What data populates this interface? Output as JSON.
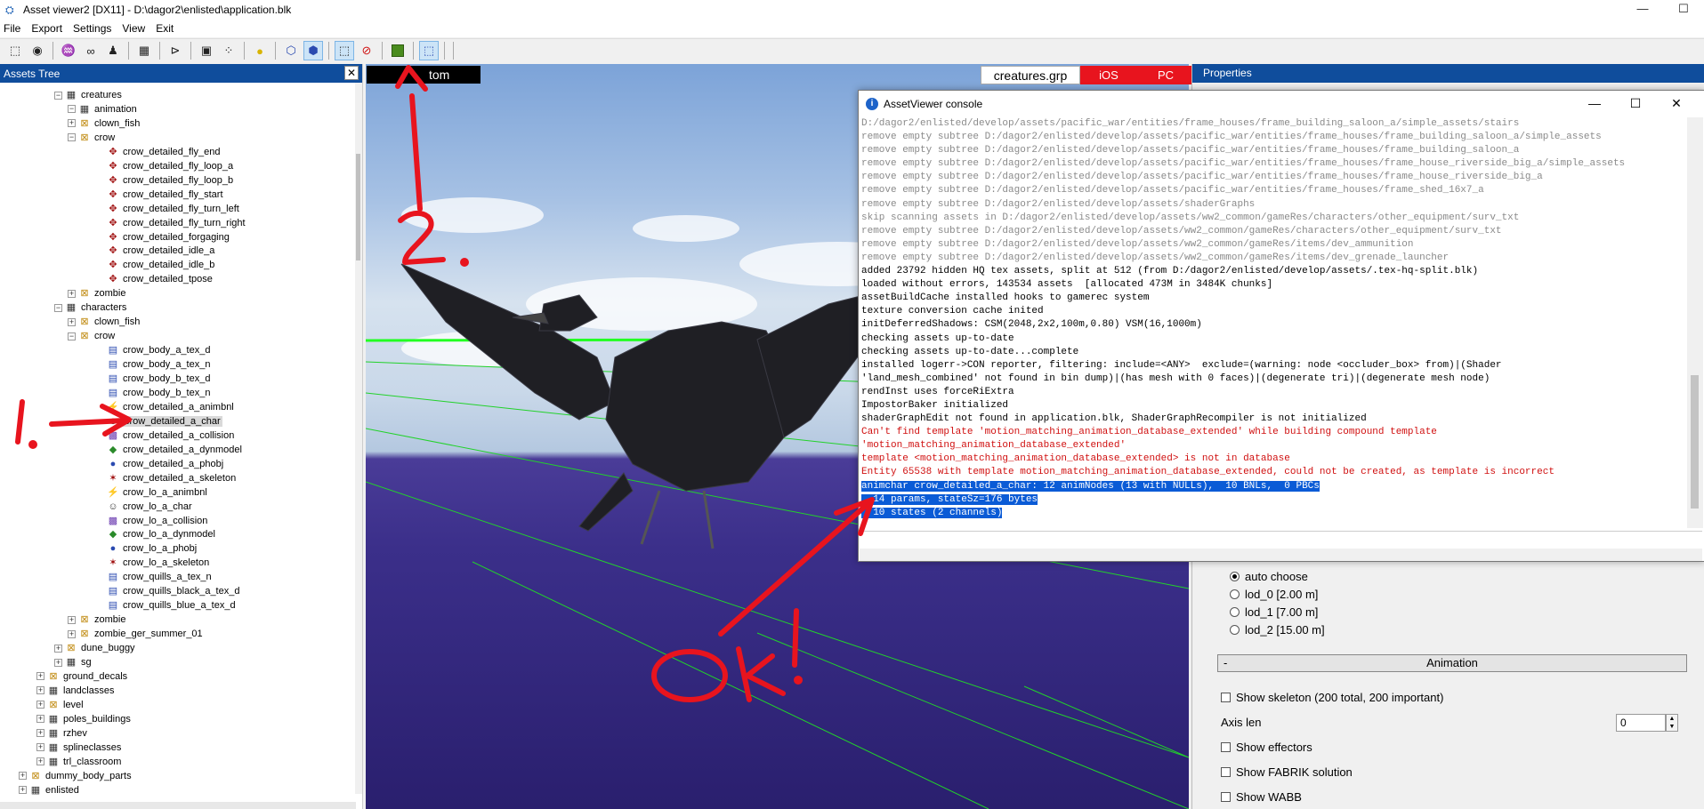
{
  "window": {
    "title": "Asset viewer2  [DX11]  -  D:\\dagor2\\enlisted\\application.blk",
    "minimize": "—",
    "maximize": "☐"
  },
  "menu": [
    "File",
    "Export",
    "Settings",
    "View",
    "Exit"
  ],
  "toolbar_icons": [
    "frame-icon",
    "eye-icon",
    "wave-icon",
    "links-icon",
    "figure-icon",
    "grid-icon",
    "camera-back-icon",
    "camera-icon",
    "dots-icon",
    "sun-icon",
    "cube-icon",
    "cube-solid-icon",
    "frame2-icon",
    "no-shadow-icon",
    "green-square-icon",
    "dotted-frame-icon"
  ],
  "tree": {
    "title": "Assets Tree",
    "close": "✕",
    "items": [
      {
        "label": "creatures",
        "kind": "group"
      },
      {
        "label": "animation",
        "kind": "group"
      },
      {
        "label": "clown_fish",
        "kind": "folder"
      },
      {
        "label": "crow",
        "kind": "folder"
      },
      {
        "label": "crow_detailed_fly_end",
        "kind": "anim"
      },
      {
        "label": "crow_detailed_fly_loop_a",
        "kind": "anim"
      },
      {
        "label": "crow_detailed_fly_loop_b",
        "kind": "anim"
      },
      {
        "label": "crow_detailed_fly_start",
        "kind": "anim"
      },
      {
        "label": "crow_detailed_fly_turn_left",
        "kind": "anim"
      },
      {
        "label": "crow_detailed_fly_turn_right",
        "kind": "anim"
      },
      {
        "label": "crow_detailed_forgaging",
        "kind": "anim"
      },
      {
        "label": "crow_detailed_idle_a",
        "kind": "anim"
      },
      {
        "label": "crow_detailed_idle_b",
        "kind": "anim"
      },
      {
        "label": "crow_detailed_tpose",
        "kind": "anim"
      },
      {
        "label": "zombie",
        "kind": "folder"
      },
      {
        "label": "characters",
        "kind": "group"
      },
      {
        "label": "clown_fish",
        "kind": "folder"
      },
      {
        "label": "crow",
        "kind": "folder"
      },
      {
        "label": "crow_body_a_tex_d",
        "kind": "tex"
      },
      {
        "label": "crow_body_a_tex_n",
        "kind": "tex"
      },
      {
        "label": "crow_body_b_tex_d",
        "kind": "tex"
      },
      {
        "label": "crow_body_b_tex_n",
        "kind": "tex"
      },
      {
        "label": "crow_detailed_a_animbnl",
        "kind": "animbnl"
      },
      {
        "label": "crow_detailed_a_char",
        "kind": "char"
      },
      {
        "label": "crow_detailed_a_collision",
        "kind": "collision"
      },
      {
        "label": "crow_detailed_a_dynmodel",
        "kind": "dynmodel"
      },
      {
        "label": "crow_detailed_a_phobj",
        "kind": "phobj"
      },
      {
        "label": "crow_detailed_a_skeleton",
        "kind": "skeleton"
      },
      {
        "label": "crow_lo_a_animbnl",
        "kind": "animbnl"
      },
      {
        "label": "crow_lo_a_char",
        "kind": "char"
      },
      {
        "label": "crow_lo_a_collision",
        "kind": "collision"
      },
      {
        "label": "crow_lo_a_dynmodel",
        "kind": "dynmodel"
      },
      {
        "label": "crow_lo_a_phobj",
        "kind": "phobj"
      },
      {
        "label": "crow_lo_a_skeleton",
        "kind": "skeleton"
      },
      {
        "label": "crow_quills_a_tex_n",
        "kind": "tex"
      },
      {
        "label": "crow_quills_black_a_tex_d",
        "kind": "tex"
      },
      {
        "label": "crow_quills_blue_a_tex_d",
        "kind": "tex"
      },
      {
        "label": "zombie",
        "kind": "folder"
      },
      {
        "label": "zombie_ger_summer_01",
        "kind": "folder"
      },
      {
        "label": "dune_buggy",
        "kind": "folder"
      },
      {
        "label": "sg",
        "kind": "group"
      },
      {
        "label": "ground_decals",
        "kind": "folder"
      },
      {
        "label": "landclasses",
        "kind": "group"
      },
      {
        "label": "level",
        "kind": "folder"
      },
      {
        "label": "poles_buildings",
        "kind": "group"
      },
      {
        "label": "rzhev",
        "kind": "group"
      },
      {
        "label": "splineclasses",
        "kind": "group"
      },
      {
        "label": "trl_classroom",
        "kind": "group"
      },
      {
        "label": "dummy_body_parts",
        "kind": "folder"
      },
      {
        "label": "enlisted",
        "kind": "group"
      }
    ]
  },
  "viewport": {
    "label": "tom",
    "file": "creatures.grp",
    "platforms": [
      "iOS",
      "PC"
    ],
    "platform_color": "#e8141e"
  },
  "console": {
    "title": "AssetViewer console",
    "close": "✕",
    "lines": [
      {
        "t": "D:/dagor2/enlisted/develop/assets/pacific_war/entities/frame_houses/frame_building_saloon_a/simple_assets/stairs",
        "c": "gray"
      },
      {
        "t": "remove empty subtree D:/dagor2/enlisted/develop/assets/pacific_war/entities/frame_houses/frame_building_saloon_a/simple_assets",
        "c": "gray"
      },
      {
        "t": "remove empty subtree D:/dagor2/enlisted/develop/assets/pacific_war/entities/frame_houses/frame_building_saloon_a",
        "c": "gray"
      },
      {
        "t": "remove empty subtree D:/dagor2/enlisted/develop/assets/pacific_war/entities/frame_houses/frame_house_riverside_big_a/simple_assets",
        "c": "gray"
      },
      {
        "t": "remove empty subtree D:/dagor2/enlisted/develop/assets/pacific_war/entities/frame_houses/frame_house_riverside_big_a",
        "c": "gray"
      },
      {
        "t": "remove empty subtree D:/dagor2/enlisted/develop/assets/pacific_war/entities/frame_houses/frame_shed_16x7_a",
        "c": "gray"
      },
      {
        "t": "remove empty subtree D:/dagor2/enlisted/develop/assets/shaderGraphs",
        "c": "gray"
      },
      {
        "t": "skip scanning assets in D:/dagor2/enlisted/develop/assets/ww2_common/gameRes/characters/other_equipment/surv_txt",
        "c": "gray"
      },
      {
        "t": "remove empty subtree D:/dagor2/enlisted/develop/assets/ww2_common/gameRes/characters/other_equipment/surv_txt",
        "c": "gray"
      },
      {
        "t": "remove empty subtree D:/dagor2/enlisted/develop/assets/ww2_common/gameRes/items/dev_ammunition",
        "c": "gray"
      },
      {
        "t": "remove empty subtree D:/dagor2/enlisted/develop/assets/ww2_common/gameRes/items/dev_grenade_launcher",
        "c": "gray"
      },
      {
        "t": "added 23792 hidden HQ tex assets, split at 512 (from D:/dagor2/enlisted/develop/assets/.tex-hq-split.blk)",
        "c": "black"
      },
      {
        "t": "loaded without errors, 143534 assets  [allocated 473M in 3484K chunks]",
        "c": "black"
      },
      {
        "t": "assetBuildCache installed hooks to gamerec system",
        "c": "black"
      },
      {
        "t": "texture conversion cache inited",
        "c": "black"
      },
      {
        "t": "initDeferredShadows: CSM(2048,2x2,100m,0.80) VSM(16,1000m)",
        "c": "black"
      },
      {
        "t": "checking assets up-to-date",
        "c": "black"
      },
      {
        "t": "checking assets up-to-date...complete",
        "c": "black"
      },
      {
        "t": "installed logerr->CON reporter, filtering: include=<ANY>  exclude=(warning: node <occluder_box> from)|(Shader",
        "c": "black"
      },
      {
        "t": "'land_mesh_combined' not found in bin dump)|(has mesh with 0 faces)|(degenerate tri)|(degenerate mesh node)",
        "c": "black"
      },
      {
        "t": "rendInst uses forceRiExtra",
        "c": "black"
      },
      {
        "t": "ImpostorBaker initialized",
        "c": "black"
      },
      {
        "t": "shaderGraphEdit not found in application.blk, ShaderGraphRecompiler is not initialized",
        "c": "black"
      },
      {
        "t": "Can't find template 'motion_matching_animation_database_extended' while building compound template",
        "c": "red"
      },
      {
        "t": "'motion_matching_animation_database_extended'",
        "c": "red"
      },
      {
        "t": "template <motion_matching_animation_database_extended> is not in database",
        "c": "red"
      },
      {
        "t": "Entity 65538 with template motion_matching_animation_database_extended, could not be created, as template is incorrect",
        "c": "red"
      },
      {
        "t": "animchar crow_detailed_a_char: 12 animNodes (13 with NULLs),  10 BNLs,  0 PBCs",
        "c": "hl"
      },
      {
        "t": "  14 params, stateSz=176 bytes",
        "c": "hl"
      },
      {
        "t": "  10 states (2 channels)",
        "c": "hl"
      }
    ]
  },
  "properties": {
    "title": "Properties",
    "lod_options": [
      "auto choose",
      "lod_0 [2.00 m]",
      "lod_1 [7.00 m]",
      "lod_2 [15.00 m]"
    ],
    "lod_selected": 0,
    "animation_group": "Animation",
    "animation_group_minus": "-",
    "show_skeleton": "Show skeleton (200 total, 200 important)",
    "axis_len_label": "Axis len",
    "axis_len_value": "0",
    "show_effectors": "Show effectors",
    "show_fabrik": "Show FABRIK solution",
    "show_wabb": "Show WABB"
  },
  "annotations": {
    "color": "#e8141e",
    "marks": [
      "1.",
      "2.",
      "Ok!"
    ]
  }
}
